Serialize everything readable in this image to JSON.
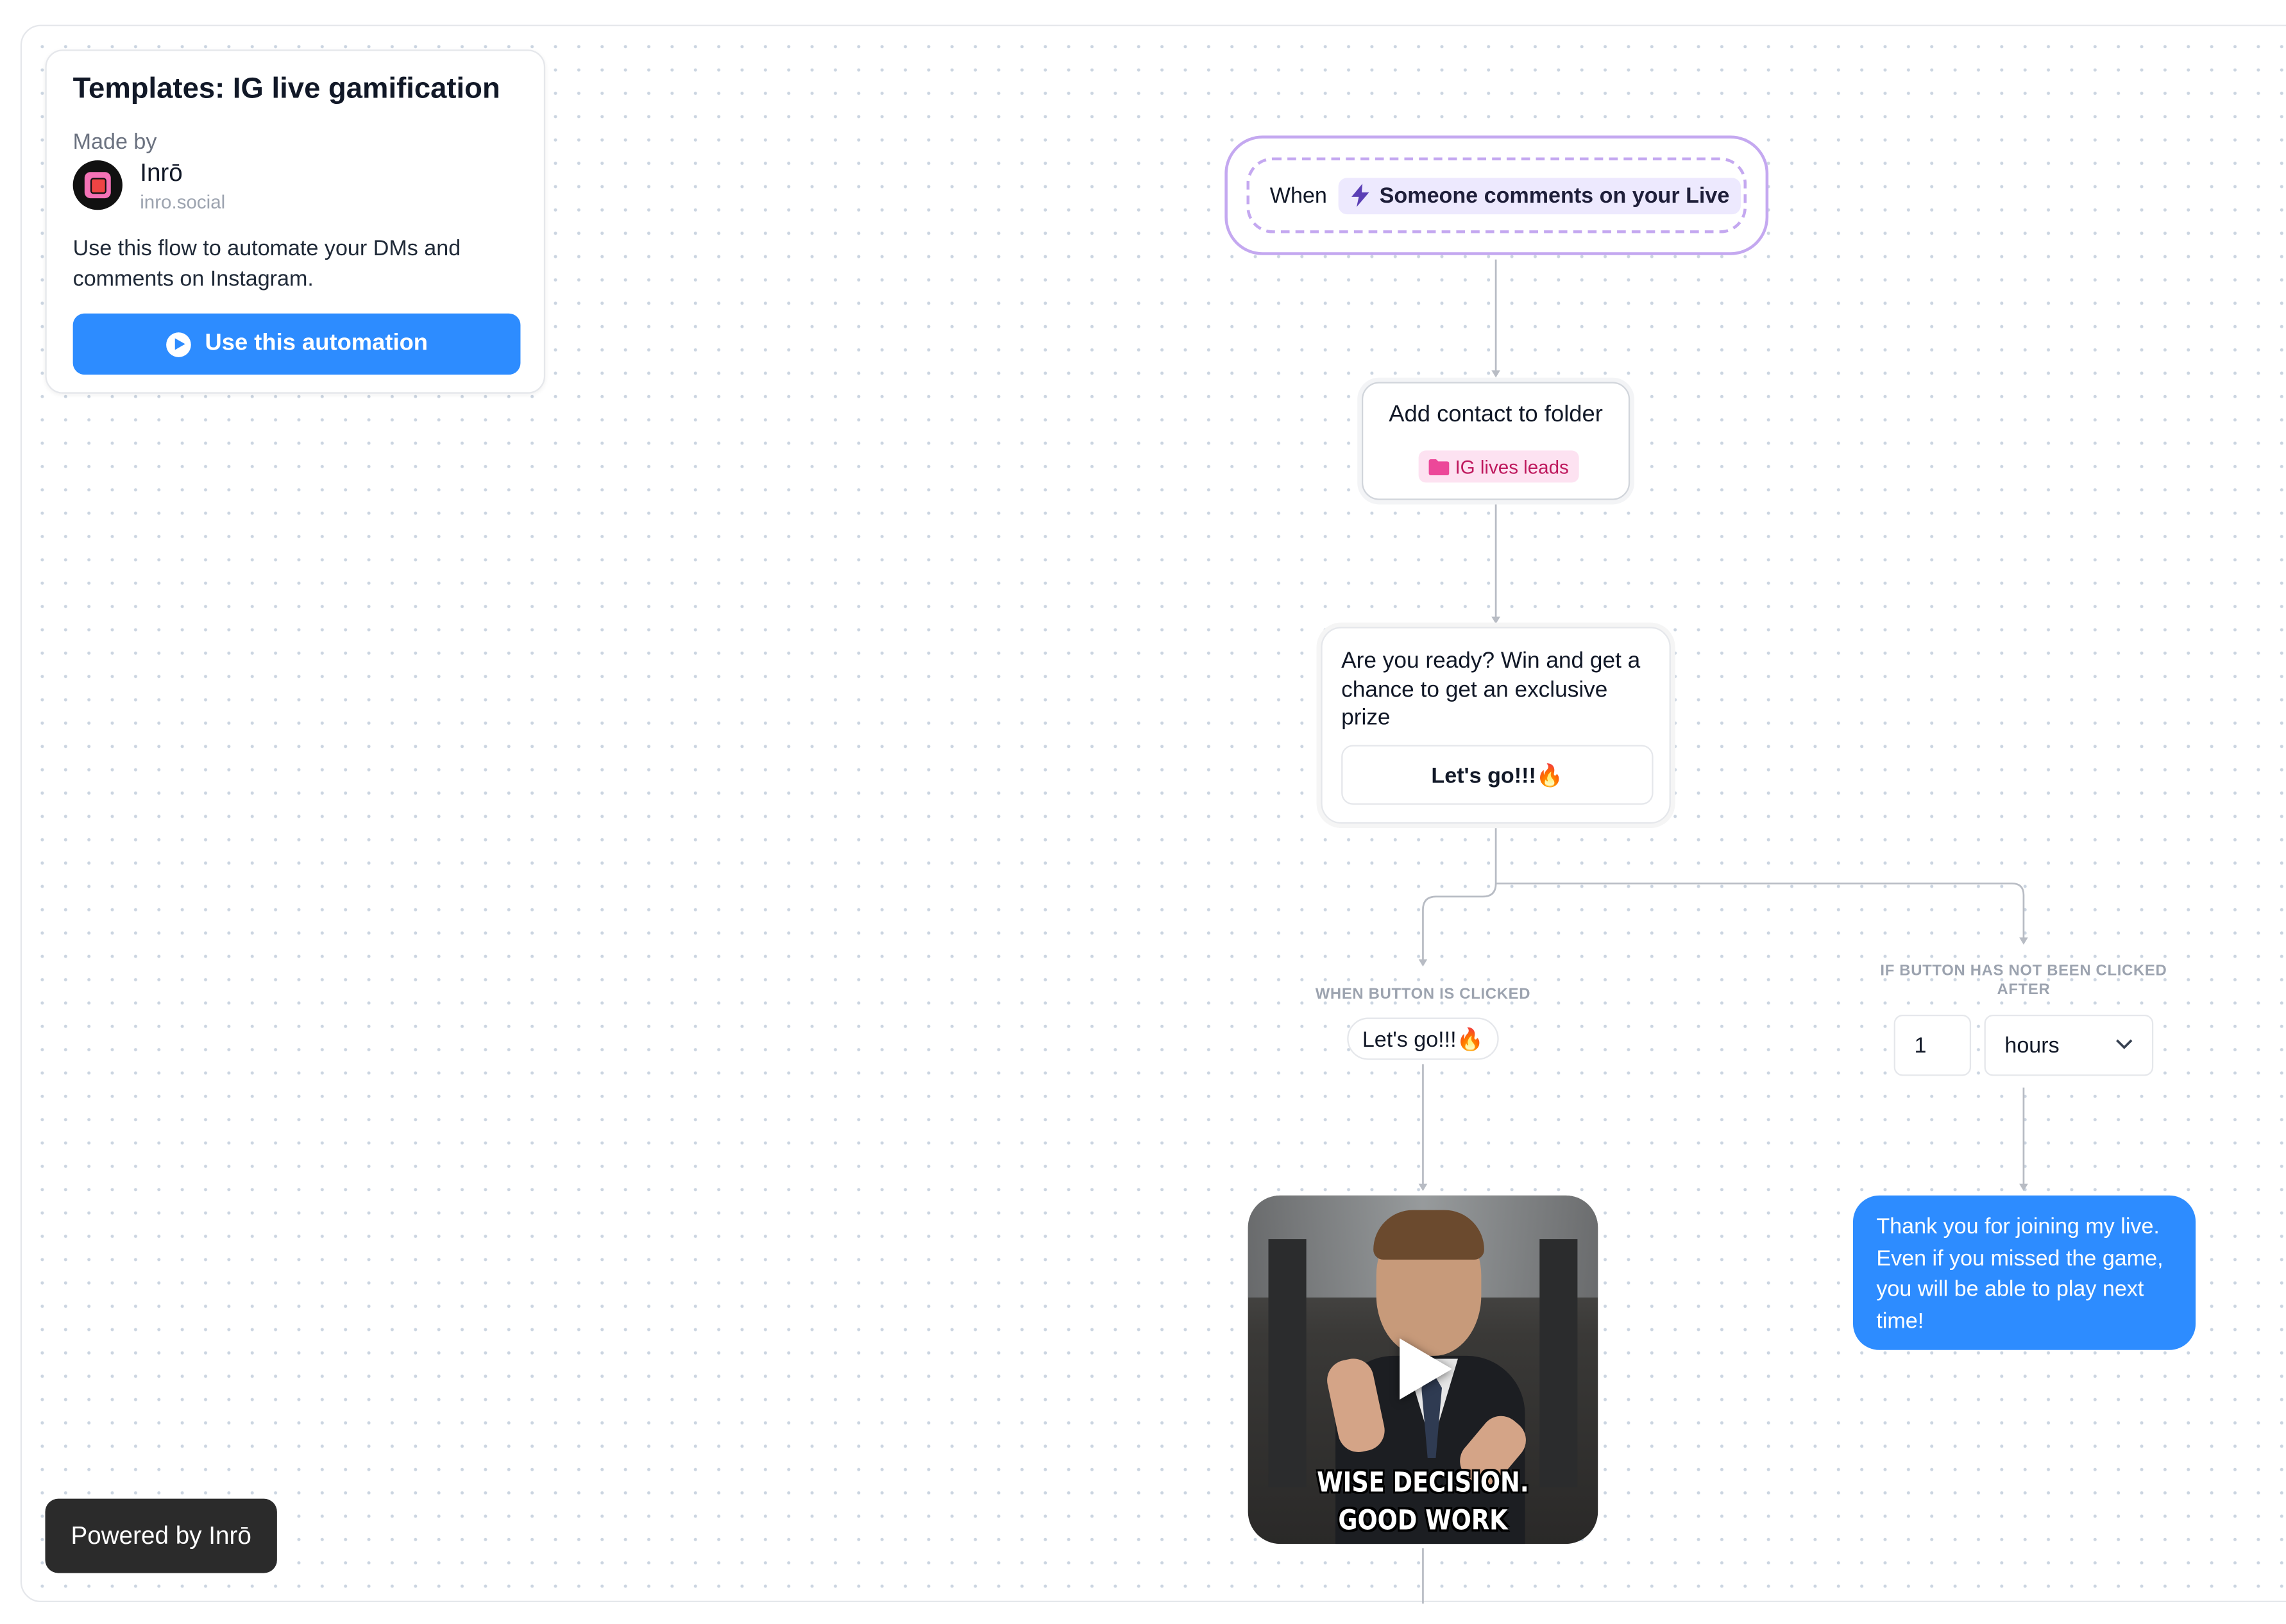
{
  "info_card": {
    "title": "Templates: IG live gamification",
    "made_by_label": "Made by",
    "author_name": "Inrō",
    "author_domain": "inro.social",
    "description": "Use this flow to automate your DMs and comments on Instagram.",
    "cta_label": "Use this automation",
    "cta_color": "#2d8cff"
  },
  "trigger": {
    "when_label": "When",
    "event": "Someone comments on your Live",
    "icon": "lightning-icon",
    "accent": "#c4a8f0"
  },
  "folder_step": {
    "title": "Add contact to folder",
    "folder_name": "IG lives leads",
    "icon": "folder-icon"
  },
  "message_step": {
    "text": "Are you ready? Win and get a chance to get an exclusive prize",
    "button_label": "Let's go!!!🔥"
  },
  "branch_clicked": {
    "label": "WHEN BUTTON IS CLICKED",
    "button_label": "Let's go!!!🔥"
  },
  "branch_not_clicked": {
    "label": "IF BUTTON HAS NOT BEEN CLICKED AFTER",
    "delay_value": "1",
    "delay_unit": "hours"
  },
  "gif_step": {
    "caption_line1": "WISE DECISION.",
    "caption_line2": "GOOD WORK",
    "icon": "play-icon"
  },
  "reply_message": {
    "text": "Thank you for joining my live. Even if you missed the game, you will be able to play next time!",
    "color": "#2d8cff"
  },
  "powered_badge": {
    "label": "Powered by Inrō"
  }
}
